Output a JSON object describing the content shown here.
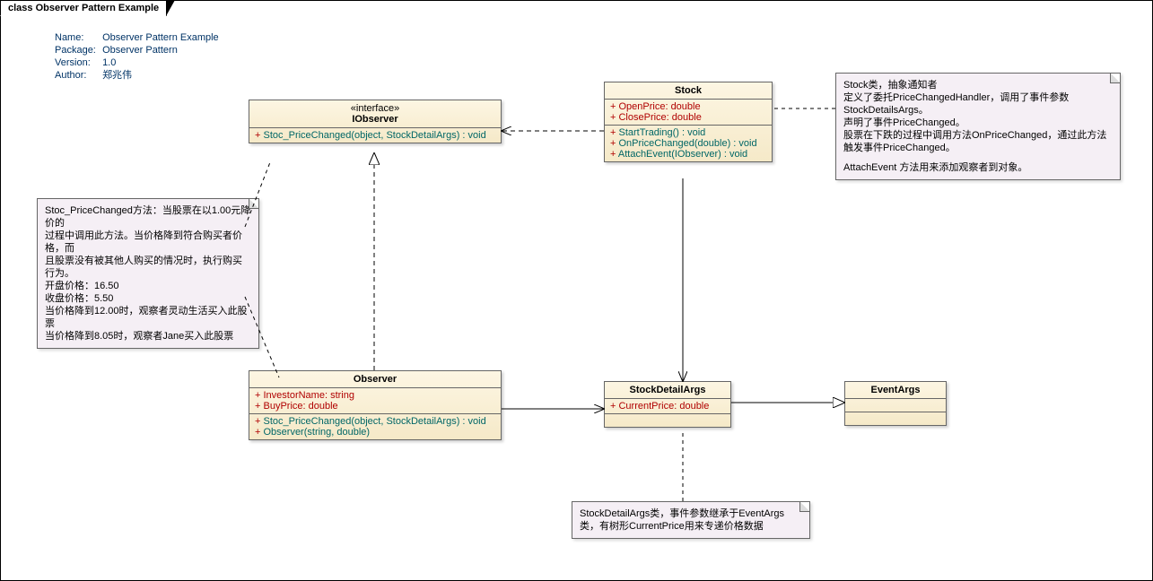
{
  "diagram": {
    "tab": "class Observer Pattern Example"
  },
  "meta": {
    "labels": {
      "name": "Name:",
      "package": "Package:",
      "version": "Version:",
      "author": "Author:"
    },
    "values": {
      "name": "Observer Pattern Example",
      "package": "Observer Pattern",
      "version": "1.0",
      "author": "郑兆伟"
    }
  },
  "classes": {
    "iobserver": {
      "stereotype": "«interface»",
      "name": "IObserver",
      "methods": [
        "Stoc_PriceChanged(object, StockDetailArgs) : void"
      ]
    },
    "stock": {
      "name": "Stock",
      "attrs": [
        "OpenPrice: double",
        "ClosePrice: double"
      ],
      "methods": [
        "StartTrading() : void",
        "OnPriceChanged(double) : void",
        "AttachEvent(IObserver) : void"
      ]
    },
    "observer": {
      "name": "Observer",
      "attrs": [
        "InvestorName: string",
        "BuyPrice: double"
      ],
      "methods": [
        "Stoc_PriceChanged(object, StockDetailArgs) : void",
        "Observer(string, double)"
      ]
    },
    "stockdetailargs": {
      "name": "StockDetailArgs",
      "attrs": [
        "CurrentPrice: double"
      ]
    },
    "eventargs": {
      "name": "EventArgs"
    }
  },
  "notes": {
    "iobserver": [
      "Stoc_PriceChanged方法：当股票在以1.00元降价的",
      "过程中调用此方法。当价格降到符合购买者价格，而",
      "且股票没有被其他人购买的情况时，执行购买行为。",
      "开盘价格：16.50",
      "收盘价格：5.50",
      "当价格降到12.00时，观察者灵动生活买入此股票",
      "当价格降到8.05时，观察者Jane买入此股票"
    ],
    "stock": [
      "Stock类，抽象通知者",
      "定义了委托PriceChangedHandler，调用了事件参数StockDetailsArgs。",
      "声明了事件PriceChanged。",
      "股票在下跌的过程中调用方法OnPriceChanged，通过此方法触发事件PriceChanged。",
      "AttachEvent 方法用来添加观察者到对象。"
    ],
    "stockdetailargs": [
      "StockDetailArgs类，事件参数继承于EventArgs",
      "类，有树形CurrentPrice用来专递价格数据"
    ]
  }
}
